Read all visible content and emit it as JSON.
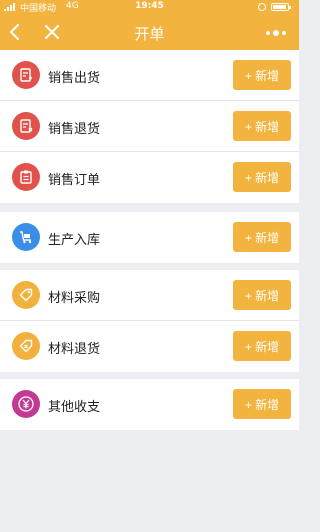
{
  "status_bar": {
    "carrier": "中国移动",
    "network": "4G",
    "time": "19:45"
  },
  "nav": {
    "title": "开单",
    "back_icon": "chevron-left-icon",
    "close_icon": "close-icon",
    "more_icon": "more-dots-icon"
  },
  "colors": {
    "accent": "#f3b43f",
    "red": "#e0524b",
    "blue": "#3b8ee8",
    "orange": "#f2b13d",
    "purple": "#c23a93"
  },
  "groups": [
    {
      "items": [
        {
          "label": "销售出货",
          "button": "+ 新增",
          "icon": "invoice-out-icon"
        },
        {
          "label": "销售退货",
          "button": "+ 新增",
          "icon": "invoice-return-icon"
        },
        {
          "label": "销售订单",
          "button": "+ 新增",
          "icon": "clipboard-icon"
        }
      ]
    },
    {
      "items": [
        {
          "label": "生产入库",
          "button": "+ 新增",
          "icon": "cart-icon"
        }
      ]
    },
    {
      "items": [
        {
          "label": "材料采购",
          "button": "+ 新增",
          "icon": "tag-icon"
        },
        {
          "label": "材料退货",
          "button": "+ 新增",
          "icon": "tag-return-icon"
        }
      ]
    },
    {
      "items": [
        {
          "label": "其他收支",
          "button": "+ 新增",
          "icon": "yuan-icon"
        }
      ]
    }
  ]
}
